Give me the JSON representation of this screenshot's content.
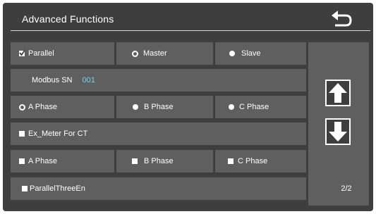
{
  "header": {
    "title": "Advanced Functions"
  },
  "rows": {
    "parallel": {
      "label": "Parallel",
      "checked": true
    },
    "master": {
      "label": "Master",
      "selected": true
    },
    "slave": {
      "label": "Slave",
      "selected": false
    },
    "modbus_sn": {
      "label": "Modbus SN",
      "value": "001"
    },
    "phase_a": {
      "label": "A Phase",
      "selected": true
    },
    "phase_b": {
      "label": "B Phase",
      "selected": false
    },
    "phase_c": {
      "label": "C Phase",
      "selected": false
    },
    "ex_meter": {
      "label": "Ex_Meter For CT",
      "checked": false
    },
    "ct_phase_a": {
      "label": "A Phase",
      "checked": false
    },
    "ct_phase_b": {
      "label": "B Phase",
      "checked": false
    },
    "ct_phase_c": {
      "label": "C Phase",
      "checked": false
    },
    "parallel_three_en": {
      "label": "ParallelThreeEn",
      "checked": false
    }
  },
  "pagination": {
    "page": "2/2"
  },
  "icons": {
    "back": "back-arrow-icon",
    "up": "up-arrow-icon",
    "down": "down-arrow-icon",
    "check": "check-icon"
  },
  "colors": {
    "background": "#3e3e3e",
    "cell": "#5f5f5f",
    "accent_value": "#6fd6e8",
    "text": "#ffffff"
  }
}
